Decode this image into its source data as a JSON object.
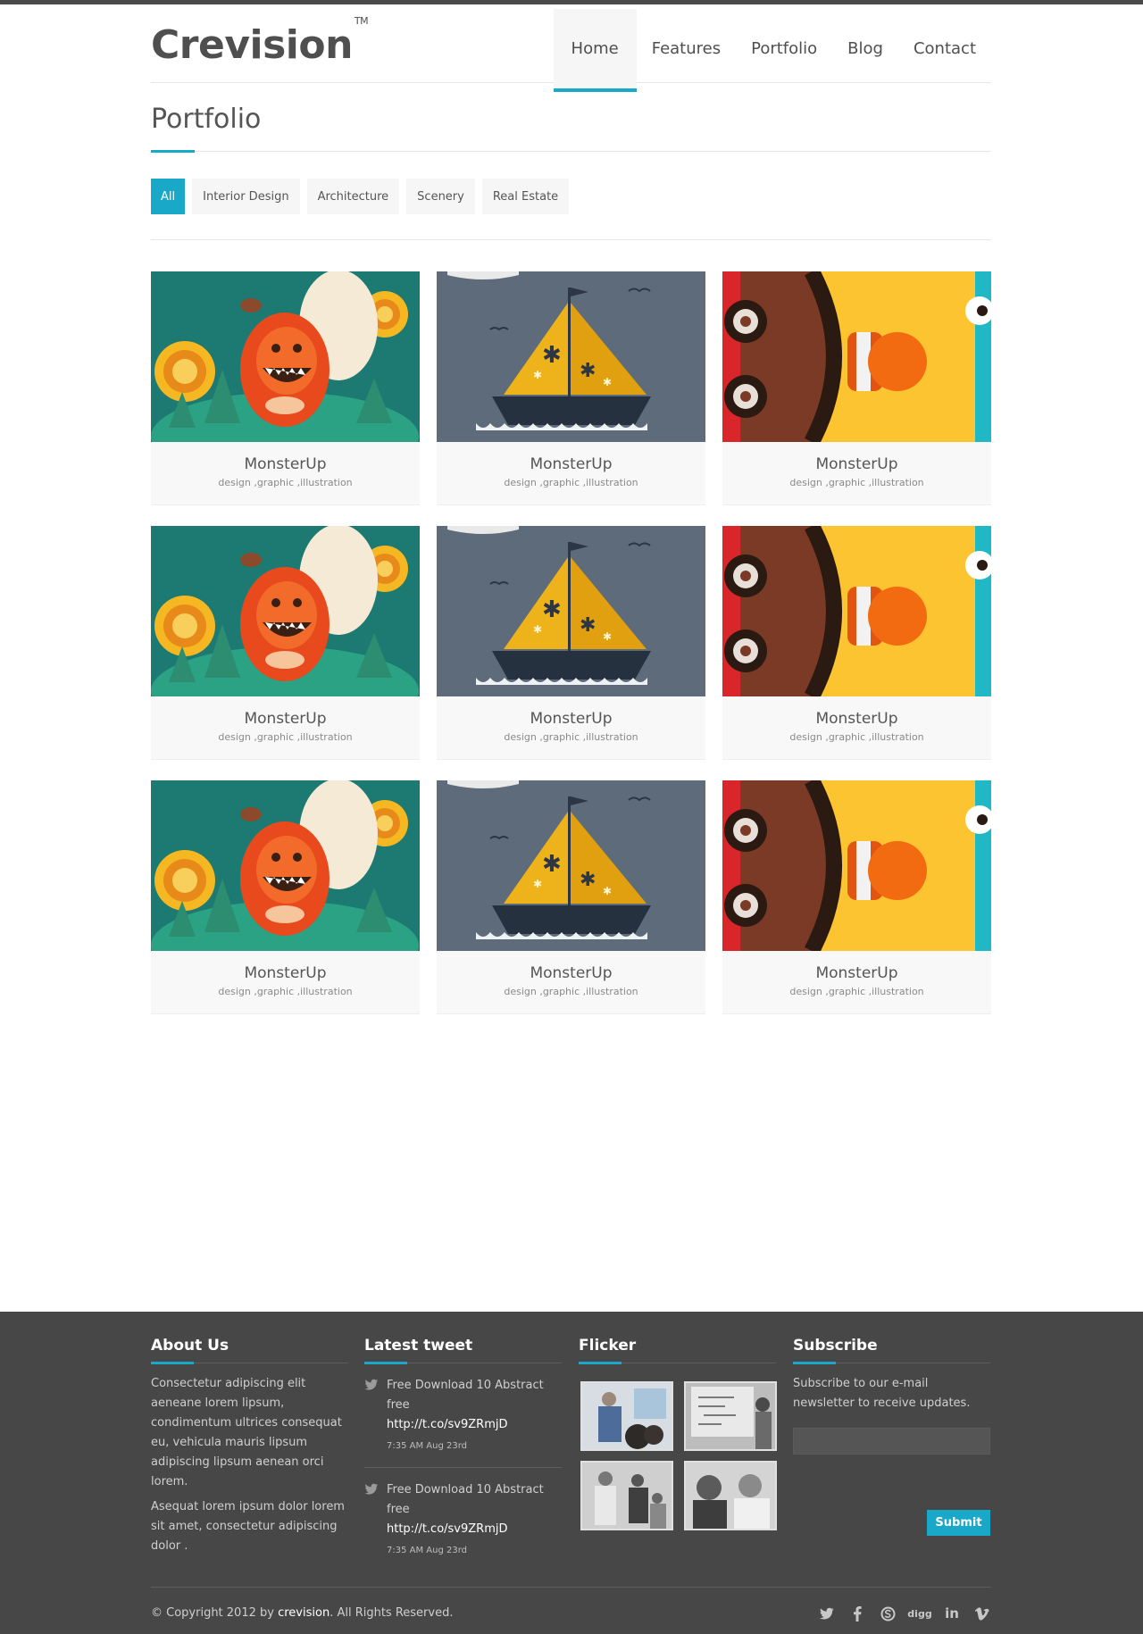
{
  "brand": {
    "name": "Crevision",
    "tm": "TM"
  },
  "nav": [
    "Home",
    "Features",
    "Portfolio",
    "Blog",
    "Contact"
  ],
  "page": {
    "title": "Portfolio"
  },
  "filters": [
    "All",
    "Interior Design",
    "Architecture",
    "Scenery",
    "Real Estate"
  ],
  "portfolio": [
    {
      "title": "MonsterUp",
      "tags": "design ,graphic ,illustration",
      "art": "monster"
    },
    {
      "title": "MonsterUp",
      "tags": "design ,graphic ,illustration",
      "art": "boat"
    },
    {
      "title": "MonsterUp",
      "tags": "design ,graphic ,illustration",
      "art": "face"
    },
    {
      "title": "MonsterUp",
      "tags": "design ,graphic ,illustration",
      "art": "monster"
    },
    {
      "title": "MonsterUp",
      "tags": "design ,graphic ,illustration",
      "art": "boat"
    },
    {
      "title": "MonsterUp",
      "tags": "design ,graphic ,illustration",
      "art": "face"
    },
    {
      "title": "MonsterUp",
      "tags": "design ,graphic ,illustration",
      "art": "monster"
    },
    {
      "title": "MonsterUp",
      "tags": "design ,graphic ,illustration",
      "art": "boat"
    },
    {
      "title": "MonsterUp",
      "tags": "design ,graphic ,illustration",
      "art": "face"
    }
  ],
  "footer": {
    "about": {
      "heading": "About Us",
      "p1": "Consectetur adipiscing elit aeneane lorem lipsum, condimentum ultrices consequat eu, vehicula mauris lipsum adipiscing lipsum aenean orci lorem.",
      "p2": "Asequat lorem ipsum dolor lorem sit amet, consectetur adipiscing dolor ."
    },
    "tweets": {
      "heading": "Latest tweet",
      "items": [
        {
          "text": "Free Download 10 Abstract free",
          "link": "http://t.co/sv9ZRmjD",
          "time": "7:35 AM Aug 23rd"
        },
        {
          "text": "Free Download 10 Abstract free",
          "link": "http://t.co/sv9ZRmjD",
          "time": "7:35 AM Aug 23rd"
        }
      ]
    },
    "flickr": {
      "heading": "Flicker"
    },
    "subscribe": {
      "heading": "Subscribe",
      "text": "Subscribe to our e-mail newsletter to receive updates.",
      "placeholder": "",
      "button": "Submit"
    },
    "copyright": {
      "prefix": "© Copyright 2012 by ",
      "brand": "crevision",
      "suffix": ". All Rights Reserved."
    },
    "social": [
      {
        "icon": "twitter-icon"
      },
      {
        "icon": "facebook-icon"
      },
      {
        "icon": "skype-icon"
      },
      {
        "icon": "digg-icon",
        "label": "digg"
      },
      {
        "icon": "linkedin-icon",
        "label": "in"
      },
      {
        "icon": "vimeo-icon"
      }
    ]
  },
  "colors": {
    "accent": "#19a8c8",
    "footer_bg": "#474747",
    "dark_bar": "#4a4a4a"
  }
}
